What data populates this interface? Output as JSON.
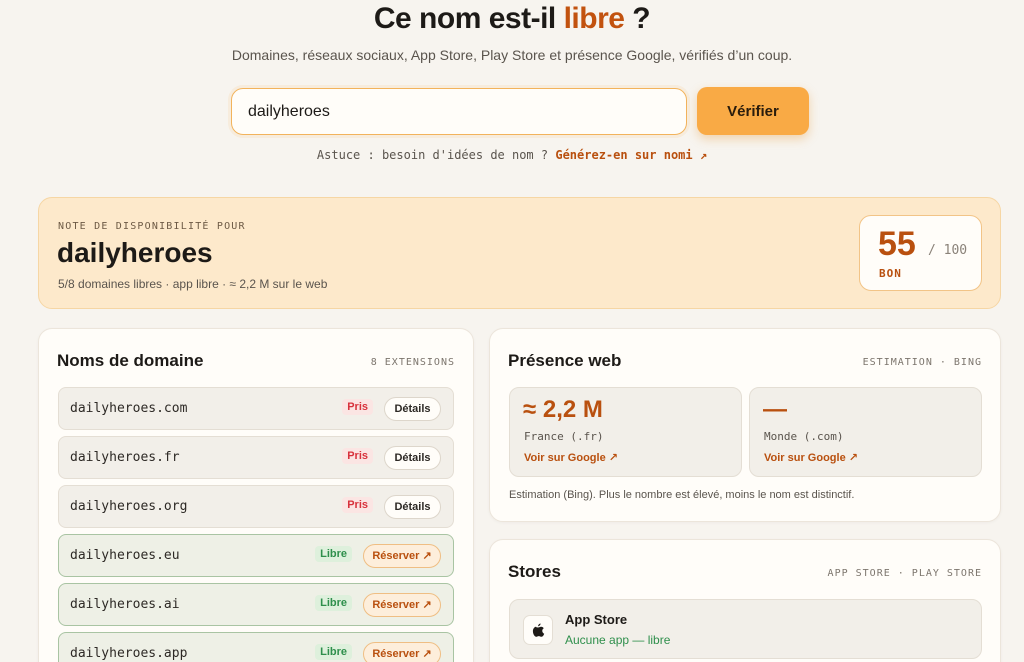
{
  "header": {
    "title_main": "Ce nom est-il",
    "title_accent": "libre",
    "title_end": "?",
    "subtitle": "Domaines, réseaux sociaux, App Store, Play Store et présence Google, vérifiés d’un coup."
  },
  "search": {
    "value": "dailyheroes",
    "button_label": "Vérifier"
  },
  "tip": {
    "text": "Astuce : besoin d'idées de nom ?",
    "link": "Générez-en sur nomi ↗"
  },
  "score": {
    "eyebrow": "NOTE DE DISPONIBILITÉ POUR",
    "name": "dailyheroes",
    "summary": "5/8 domaines libres · app libre · ≈ 2,2 M sur le web",
    "value": "55",
    "max": "/ 100",
    "label": "BON"
  },
  "domains": {
    "title": "Noms de domaine",
    "meta": "8 EXTENSIONS",
    "items": [
      {
        "name": "dailyheroes.com",
        "status": "Pris",
        "action": "Détails"
      },
      {
        "name": "dailyheroes.fr",
        "status": "Pris",
        "action": "Détails"
      },
      {
        "name": "dailyheroes.org",
        "status": "Pris",
        "action": "Détails"
      },
      {
        "name": "dailyheroes.eu",
        "status": "Libre",
        "action": "Réserver ↗"
      },
      {
        "name": "dailyheroes.ai",
        "status": "Libre",
        "action": "Réserver ↗"
      },
      {
        "name": "dailyheroes.app",
        "status": "Libre",
        "action": "Réserver ↗"
      }
    ]
  },
  "web": {
    "title": "Présence web",
    "meta": "ESTIMATION · BING",
    "boxes": [
      {
        "value": "≈ 2,2 M",
        "label": "France (.fr)",
        "link": "Voir sur Google ↗"
      },
      {
        "value": "—",
        "label": "Monde (.com)",
        "link": "Voir sur Google ↗"
      }
    ],
    "note": "Estimation (Bing). Plus le nombre est élevé, moins le nom est distinctif."
  },
  "stores": {
    "title": "Stores",
    "meta": "APP STORE · PLAY STORE",
    "items": [
      {
        "name": "App Store",
        "status": "Aucune app — libre",
        "icon": "apple-icon"
      }
    ]
  },
  "colors": {
    "accent": "#b9500f",
    "button": "#f9aa45",
    "banner": "#fde9cb",
    "taken": "#d8323c",
    "free": "#2f8f4c"
  }
}
